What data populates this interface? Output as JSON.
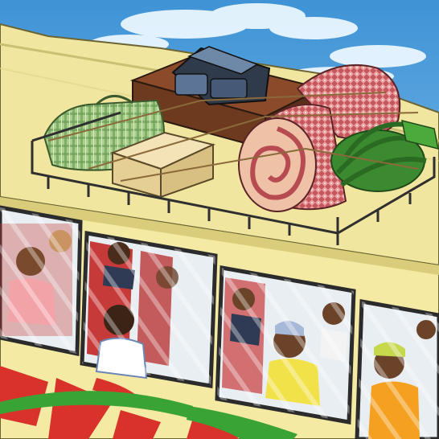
{
  "scene": {
    "subject": "illustration",
    "colors": {
      "sky_top": "#3f93d6",
      "sky_bottom": "#9fd0f0",
      "cloud": "#eaf6ff",
      "bus_body": "#f4eaa3",
      "bus_shadow": "#d9cc7a",
      "rack": "#2f2f2f",
      "window_frame": "#2b2b2b",
      "glass": "#e9eef2",
      "seat_red": "#c73a3a",
      "stripe_red": "#d9322b",
      "stripe_green": "#3aa336",
      "suitcase": "#7a3f24",
      "plaid_bag": "#9ac27a",
      "cardboard_box": "#ecd9a8",
      "mat_roll_outer": "#c75a5f",
      "mat_roll_inner": "#efc1a6",
      "bananas": "#3c8a2f",
      "machine": "#2f3a4a"
    }
  }
}
